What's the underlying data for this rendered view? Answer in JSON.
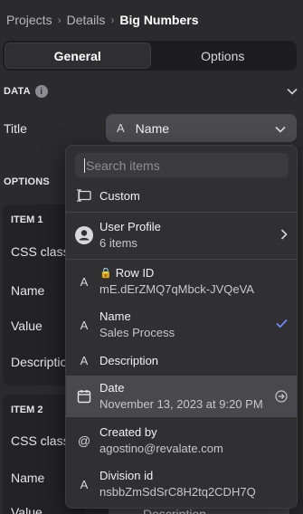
{
  "breadcrumb": {
    "items": [
      "Projects",
      "Details"
    ],
    "current": "Big Numbers"
  },
  "tabs": {
    "general": "General",
    "options": "Options"
  },
  "data_section": {
    "heading": "DATA",
    "info_glyph": "i",
    "title_label": "Title",
    "title_select": {
      "icon_glyph": "A",
      "value": "Name"
    }
  },
  "options_section": {
    "heading": "OPTIONS",
    "item1": {
      "title": "ITEM 1",
      "fields": [
        "CSS class",
        "Name",
        "Value",
        "Description"
      ]
    },
    "item2": {
      "title": "ITEM 2",
      "fields": [
        "CSS class",
        "Name",
        "Value"
      ]
    },
    "value_select_partial": "Description"
  },
  "dropdown": {
    "search_placeholder": "Search items",
    "custom": {
      "label": "Custom",
      "icon": "custom-field-icon"
    },
    "user_profile": {
      "label": "User Profile",
      "sub": "6 items",
      "icon": "user-avatar-icon"
    },
    "row_id": {
      "label": "Row ID",
      "sub": "mE.dErZMQ7qMbck-JVQeVA",
      "lock_glyph": "🔒"
    },
    "name": {
      "label": "Name",
      "sub": "Sales Process",
      "selected": true
    },
    "description": {
      "label": "Description"
    },
    "date": {
      "label": "Date",
      "sub": "November 13, 2023 at 9:20 PM",
      "icon": "calendar-icon"
    },
    "created_by": {
      "label": "Created by",
      "sub": "agostino@revalate.com",
      "icon": "at-sign-icon"
    },
    "division_id": {
      "label": "Division id",
      "sub": "nsbbZmSdSrC8H2tq2CDH7Q"
    },
    "text_type_glyph": "A"
  },
  "colors": {
    "background": "#2b2b2d",
    "popover": "#303033",
    "accent_check": "#6f8cff",
    "highlight": "#49494d"
  }
}
